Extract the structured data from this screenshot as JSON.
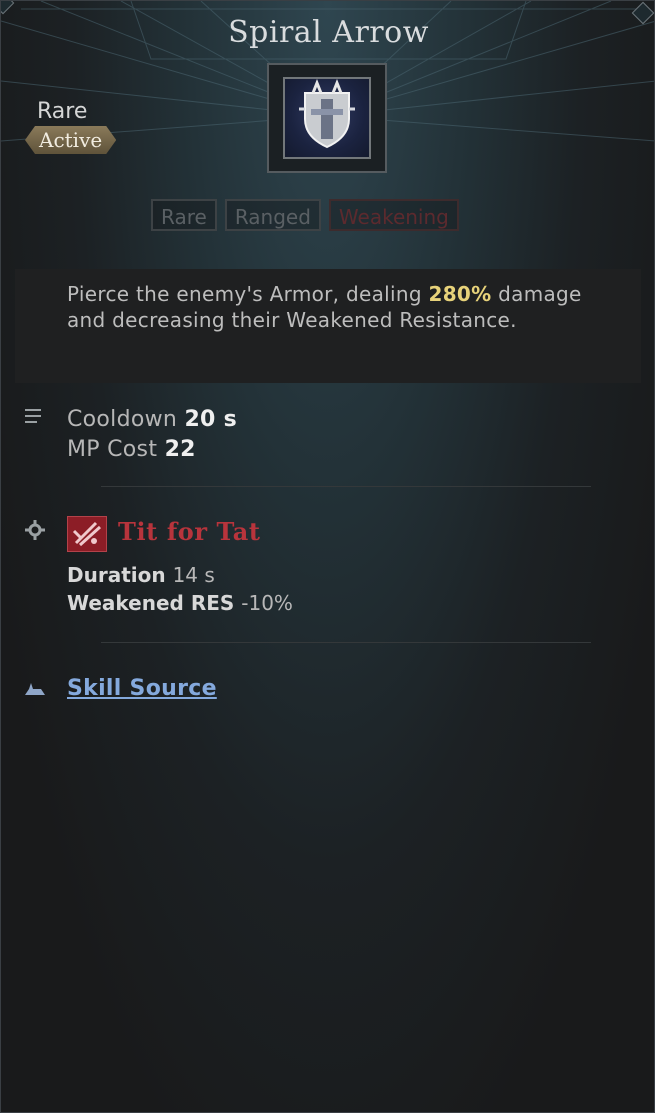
{
  "skill": {
    "title": "Spiral Arrow",
    "rarity": "Rare",
    "type": "Active",
    "icon": "shield-emblem-icon",
    "tags": [
      "Rare",
      "Ranged",
      "Weakening"
    ]
  },
  "description": {
    "before": "Pierce the enemy's Armor, dealing ",
    "highlight": "280%",
    "after": " damage and decreasing their Weakened Resistance."
  },
  "stats": {
    "icon": "list-icon",
    "cooldown_label": "Cooldown",
    "cooldown_value": "20 s",
    "mp_label": "MP Cost",
    "mp_value": "22"
  },
  "effect": {
    "row_icon": "gear-icon",
    "icon": "tit-for-tat-icon",
    "name": "Tit for Tat",
    "duration_label": "Duration",
    "duration_value": "14 s",
    "res_label": "Weakened RES",
    "res_value": "-10%"
  },
  "source": {
    "icon": "source-icon",
    "label": "Skill Source"
  },
  "colors": {
    "highlight": "#e7d27a",
    "effect_name": "#b8343c",
    "link": "#84a9dd",
    "badge": "#8a7a5a"
  }
}
